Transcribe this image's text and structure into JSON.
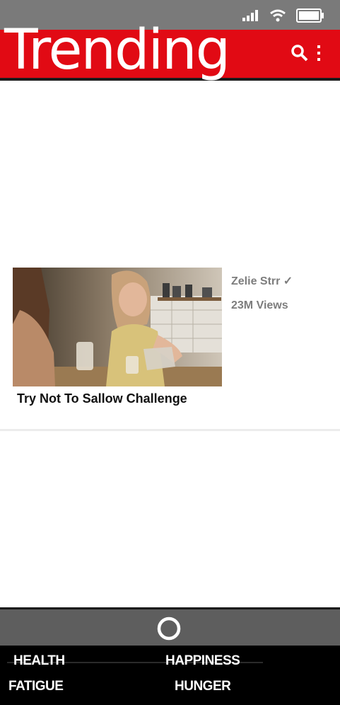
{
  "status_bar": {
    "icons": [
      "signal-icon",
      "wifi-icon",
      "battery-icon"
    ]
  },
  "header": {
    "title": "Trending",
    "actions": [
      "search-icon",
      "more-vertical-icon"
    ],
    "colors": {
      "background": "#e10a14",
      "text": "#ffffff"
    }
  },
  "video": {
    "channel": "Zelie Strr ✓",
    "views": "23M Views",
    "title": "Try Not To Sallow Challenge"
  },
  "bottom_bar": {
    "home_icon": "home-ring-icon"
  },
  "stats": {
    "health": "HEALTH",
    "happiness": "HAPPINESS",
    "fatigue": "FATIGUE",
    "hunger": "HUNGER"
  }
}
